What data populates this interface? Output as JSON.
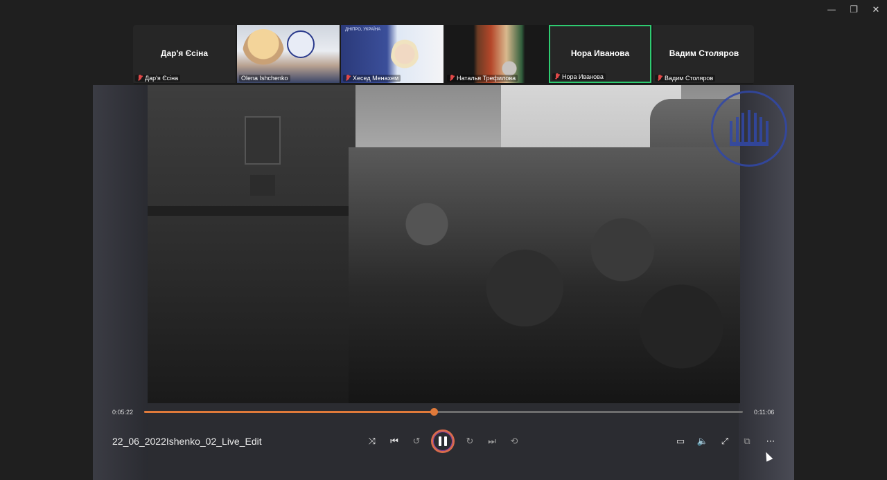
{
  "window": {
    "minimize_glyph": "—",
    "restore_glyph": "❐",
    "close_glyph": "✕"
  },
  "participants": [
    {
      "display_name": "Дар'я Єсіна",
      "label": "Дар'я Єсіна",
      "video": false,
      "muted": true,
      "active": false
    },
    {
      "display_name": "",
      "label": "Olena Ishchenko",
      "video": true,
      "muted": false,
      "active": false
    },
    {
      "display_name": "",
      "label": "Хесед Менахем",
      "video": true,
      "muted": true,
      "active": false,
      "bg_text": "ДНІПРО, УКРАЇНА"
    },
    {
      "display_name": "",
      "label": "Наталья Трефилова",
      "video": true,
      "muted": true,
      "active": false
    },
    {
      "display_name": "Нора Иванова",
      "label": "Нора Иванова",
      "video": false,
      "muted": true,
      "active": true
    },
    {
      "display_name": "Вадим Столяров",
      "label": "Вадим Столяров",
      "video": false,
      "muted": true,
      "active": false
    }
  ],
  "player": {
    "title": "22_06_2022Ishenko_02_Live_Edit",
    "current_time": "0:05:22",
    "total_time": "0:11:06",
    "progress": 0.4835,
    "state": "playing",
    "controls": {
      "shuffle_icon": "shuffle-icon",
      "previous_icon": "previous-icon",
      "rewind_icon": "rewind-10-icon",
      "pause_icon": "pause-icon",
      "forward_icon": "forward-30-icon",
      "next_icon": "next-icon",
      "repeat_icon": "repeat-off-icon",
      "miniplayer_icon": "miniplayer-icon",
      "cast_icon": "cast-icon",
      "fullscreen_icon": "fullscreen-icon",
      "volume_icon": "volume-icon",
      "more_icon": "more-icon"
    }
  },
  "colors": {
    "accent": "#e07a3a",
    "active_tile_border": "#2ecc71",
    "muted_icon": "#e04848",
    "logo_blue": "#3148a8"
  }
}
